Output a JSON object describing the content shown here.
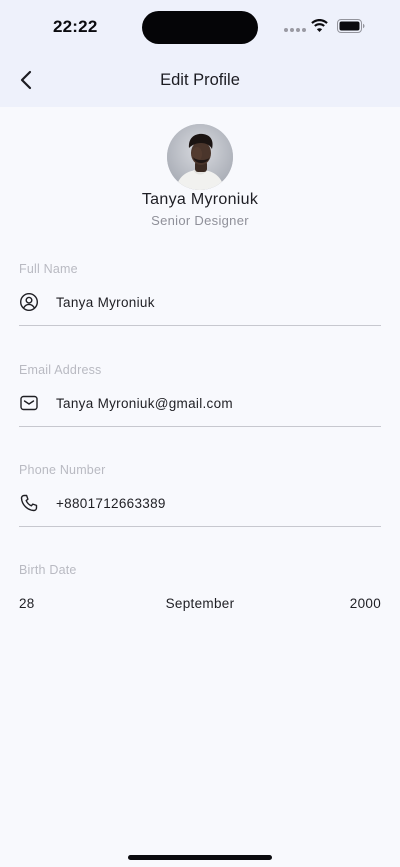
{
  "status_bar": {
    "time": "22:22"
  },
  "header": {
    "title": "Edit Profile",
    "back_icon": "chevron-left-icon"
  },
  "profile": {
    "name": "Tanya Myroniuk",
    "role": "Senior Designer"
  },
  "fields": {
    "full_name": {
      "label": "Full Name",
      "value": "Tanya Myroniuk",
      "icon": "user-circle-icon"
    },
    "email": {
      "label": "Email Address",
      "value": "Tanya Myroniuk@gmail.com",
      "icon": "mail-icon"
    },
    "phone": {
      "label": "Phone Number",
      "value": "+8801712663389",
      "icon": "phone-icon"
    },
    "birth_date": {
      "label": "Birth Date",
      "day": "28",
      "month": "September",
      "year": "2000"
    }
  },
  "colors": {
    "header_bg": "#eef1fb",
    "page_bg": "#f8f9fd",
    "label": "#b9bac2",
    "divider": "#c7c8cf"
  }
}
